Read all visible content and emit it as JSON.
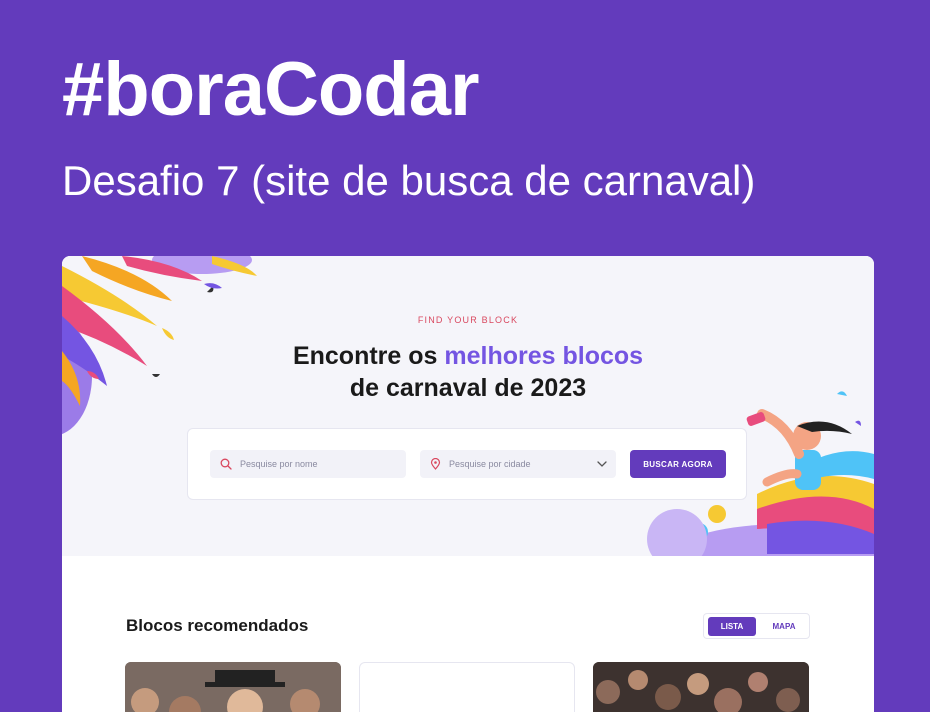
{
  "hero": {
    "title": "#boraCodar",
    "subtitle": "Desafio 7 (site de busca de carnaval)"
  },
  "site": {
    "eyebrow": "FIND YOUR BLOCK",
    "headline_part1": "Encontre os ",
    "headline_highlight": "melhores blocos",
    "headline_line2": "de carnaval de 2023",
    "search": {
      "name_placeholder": "Pesquise por nome",
      "city_placeholder": "Pesquise por cidade",
      "button_label": "BUSCAR AGORA"
    },
    "section_title": "Blocos recomendados",
    "view_toggle": {
      "list_label": "LISTA",
      "map_label": "MAPA",
      "active": "LISTA"
    }
  },
  "colors": {
    "background": "#633BBC",
    "accent": "#7455E2",
    "eyebrow": "#D9485F",
    "banner": "#F5F5FA"
  },
  "icons": [
    "search-icon",
    "map-pin-icon",
    "chevron-down-icon"
  ]
}
